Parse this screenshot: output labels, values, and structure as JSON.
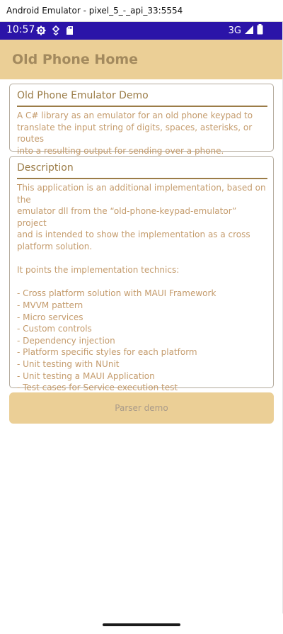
{
  "window": {
    "title": "Android Emulator - pixel_5_-_api_33:5554"
  },
  "status_bar": {
    "time": "10:57",
    "network": "3G",
    "background_color": "#2b14a8",
    "icons": [
      "settings-icon",
      "location-icon",
      "sd-card-icon",
      "signal-icon",
      "battery-icon"
    ]
  },
  "header": {
    "title": "Old Phone Home",
    "background_color": "#ebcf96"
  },
  "intro_card": {
    "title": "Old Phone Emulator Demo",
    "text": "A C# library as an emulator for an old phone keypad to\ntranslate the input string of digits, spaces, asterisks, or routes\ninto a resulting output for sending over a phone."
  },
  "description_card": {
    "title": "Description",
    "text": "This application is an additional implementation, based on the\nemulator dll from the “old-phone-keypad-emulator” project\nand is intended to show the implementation as a cross\nplatform solution.\n\nIt points the implementation technics:\n\n - Cross platform solution with MAUI Framework\n - MVVM pattern\n - Micro services\n - Custom controls\n - Dependency injection\n - Platform specific styles for each platform\n - Unit testing with NUnit\n - Unit testing a MAUI Application\n - Test cases for Service execution test\n - Test cases for Command execution test"
  },
  "actions": {
    "parser_demo_label": "Parser demo"
  },
  "colors": {
    "accent_dark": "#9b7c47",
    "body_text": "#c49b6c",
    "button_text": "#a99b8a"
  }
}
